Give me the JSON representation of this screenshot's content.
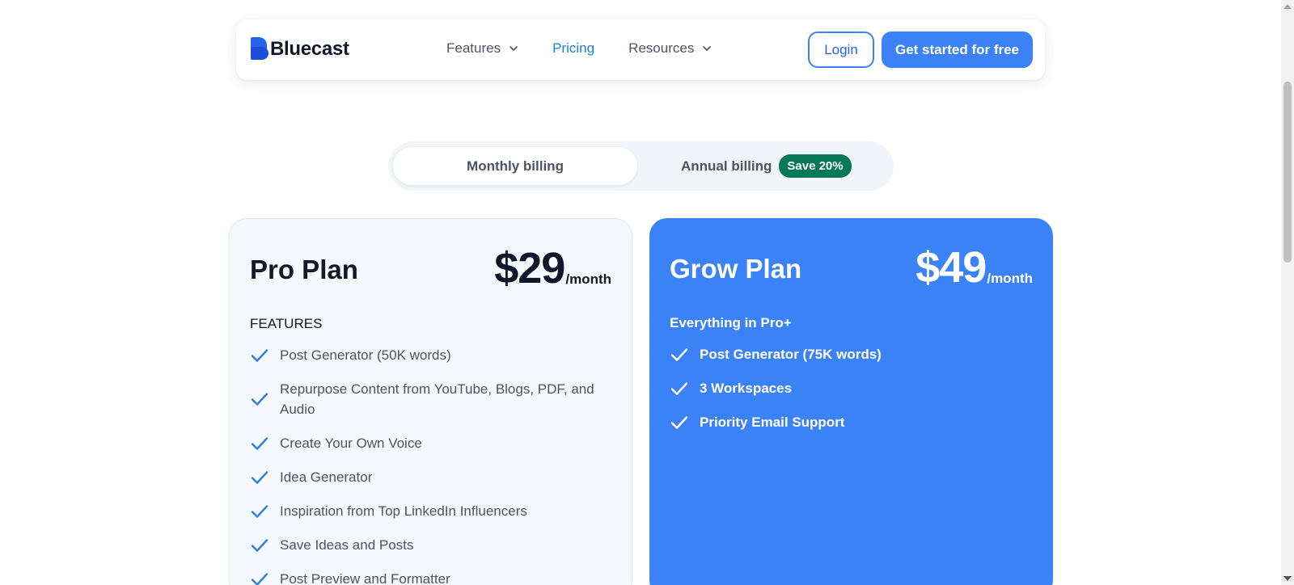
{
  "brand": {
    "name": "Bluecast"
  },
  "nav": {
    "links": [
      {
        "label": "Features",
        "has_dropdown": true,
        "active": false
      },
      {
        "label": "Pricing",
        "has_dropdown": false,
        "active": true
      },
      {
        "label": "Resources",
        "has_dropdown": true,
        "active": false
      }
    ],
    "login_label": "Login",
    "cta_label": "Get started for free"
  },
  "billing": {
    "monthly_label": "Monthly billing",
    "annual_label": "Annual billing",
    "save_badge": "Save 20%",
    "selected": "monthly"
  },
  "plans": [
    {
      "name": "Pro Plan",
      "price": "$29",
      "period": "/month",
      "section_label": "FEATURES",
      "features": [
        "Post Generator (50K words)",
        "Repurpose Content from YouTube, Blogs, PDF, and Audio",
        "Create Your Own Voice",
        "Idea Generator",
        "Inspiration from Top LinkedIn Influencers",
        "Save Ideas and Posts",
        "Post Preview and Formatter"
      ]
    },
    {
      "name": "Grow Plan",
      "price": "$49",
      "period": "/month",
      "section_label": "Everything in Pro+",
      "features": [
        "Post Generator (75K words)",
        "3 Workspaces",
        "Priority Email Support"
      ]
    }
  ],
  "colors": {
    "accent": "#3b82f6",
    "link_active": "#1d7fe0",
    "badge_green": "#047857",
    "pro_card_bg": "#f5f8fc"
  },
  "icons": {
    "feature": "check-icon",
    "dropdown": "chevron-down-icon"
  }
}
